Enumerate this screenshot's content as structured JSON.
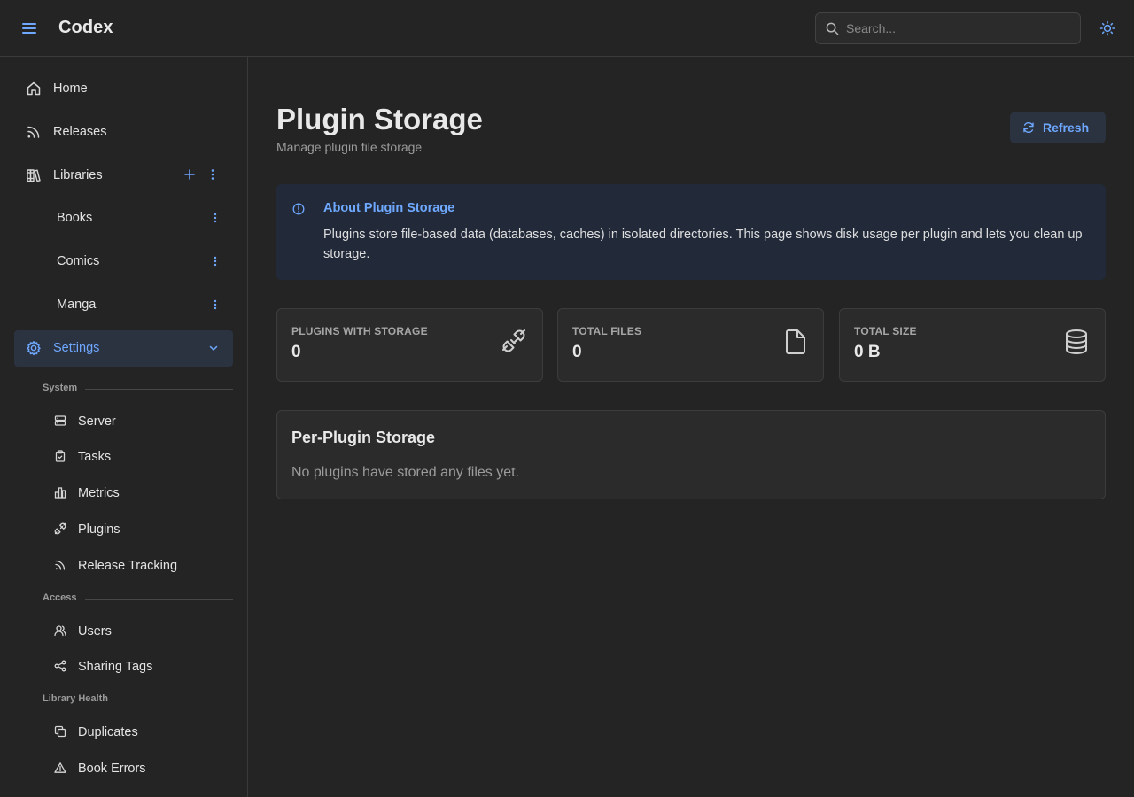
{
  "header": {
    "brand": "Codex",
    "search_placeholder": "Search...",
    "accent_color": "#6ea8ff"
  },
  "sidebar": {
    "items": [
      {
        "label": "Home",
        "icon": "home-icon"
      },
      {
        "label": "Releases",
        "icon": "rss-icon"
      },
      {
        "label": "Libraries",
        "icon": "books-icon"
      }
    ],
    "libraries": [
      {
        "label": "Books"
      },
      {
        "label": "Comics"
      },
      {
        "label": "Manga"
      }
    ],
    "settings": {
      "label": "Settings",
      "icon": "gear-icon",
      "expanded": true
    },
    "sections": [
      {
        "title": "System",
        "items": [
          {
            "label": "Server",
            "icon": "server-icon"
          },
          {
            "label": "Tasks",
            "icon": "clipboard-icon"
          },
          {
            "label": "Metrics",
            "icon": "bar-chart-icon"
          },
          {
            "label": "Plugins",
            "icon": "plug-icon"
          },
          {
            "label": "Release Tracking",
            "icon": "rss-icon"
          }
        ]
      },
      {
        "title": "Access",
        "items": [
          {
            "label": "Users",
            "icon": "users-icon"
          },
          {
            "label": "Sharing Tags",
            "icon": "share-icon"
          }
        ]
      },
      {
        "title": "Library Health",
        "items": [
          {
            "label": "Duplicates",
            "icon": "copy-icon"
          },
          {
            "label": "Book Errors",
            "icon": "warning-icon"
          }
        ]
      }
    ]
  },
  "main": {
    "title": "Plugin Storage",
    "subtitle": "Manage plugin file storage",
    "refresh_label": "Refresh",
    "alert": {
      "title": "About Plugin Storage",
      "body": "Plugins store file-based data (databases, caches) in isolated directories. This page shows disk usage per plugin and lets you clean up storage."
    },
    "stats": [
      {
        "title": "PLUGINS WITH STORAGE",
        "value": "0",
        "icon": "plug-icon"
      },
      {
        "title": "TOTAL FILES",
        "value": "0",
        "icon": "file-icon"
      },
      {
        "title": "TOTAL SIZE",
        "value": "0 B",
        "icon": "database-icon"
      }
    ],
    "per_plugin": {
      "title": "Per-Plugin Storage",
      "empty_text": "No plugins have stored any files yet."
    }
  }
}
